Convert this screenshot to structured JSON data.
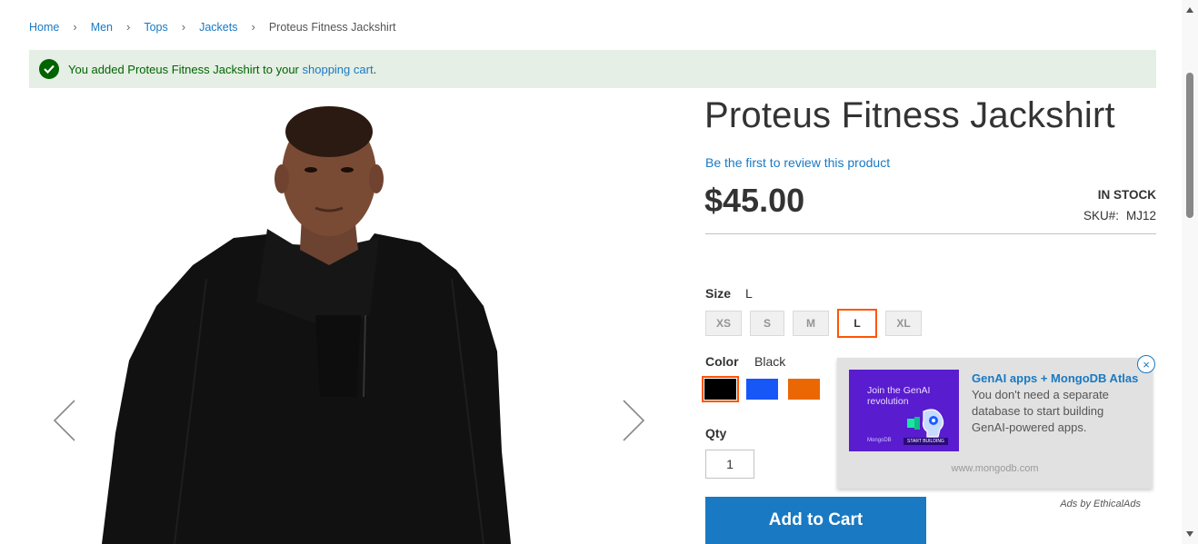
{
  "breadcrumb": {
    "items": [
      "Home",
      "Men",
      "Tops",
      "Jackets"
    ],
    "current": "Proteus Fitness Jackshirt",
    "separator": ">"
  },
  "message": {
    "text_before": "You added Proteus Fitness Jackshirt to your ",
    "link": "shopping cart",
    "text_after": "."
  },
  "product": {
    "title": "Proteus Fitness Jackshirt",
    "review_link": "Be the first to review this product",
    "price": "$45.00",
    "stock": "In stock",
    "sku_label": "SKU#:",
    "sku": "MJ12"
  },
  "size": {
    "label": "Size",
    "selected": "L",
    "options": [
      "XS",
      "S",
      "M",
      "L",
      "XL"
    ]
  },
  "color": {
    "label": "Color",
    "selected": "Black",
    "options": [
      {
        "name": "Black",
        "hex": "#000000"
      },
      {
        "name": "Blue",
        "hex": "#1857f7"
      },
      {
        "name": "Orange",
        "hex": "#eb6703"
      }
    ]
  },
  "qty": {
    "label": "Qty",
    "value": "1"
  },
  "add_to_cart": "Add to Cart",
  "ad": {
    "image_text": "Join the GenAI revolution",
    "image_brand": "MongoDB",
    "image_button": "START BUILDING",
    "headline": "GenAI apps + MongoDB Atlas",
    "body": " You don't need a separate database to start building GenAI-powered apps.",
    "domain": "www.mongodb.com",
    "close": "×",
    "attribution": "Ads by EthicalAds"
  },
  "colors": {
    "link": "#1979c3",
    "success_bg": "#e5efe5",
    "success_text": "#006400",
    "selected_outline": "#ff5501",
    "button": "#1979c3"
  }
}
